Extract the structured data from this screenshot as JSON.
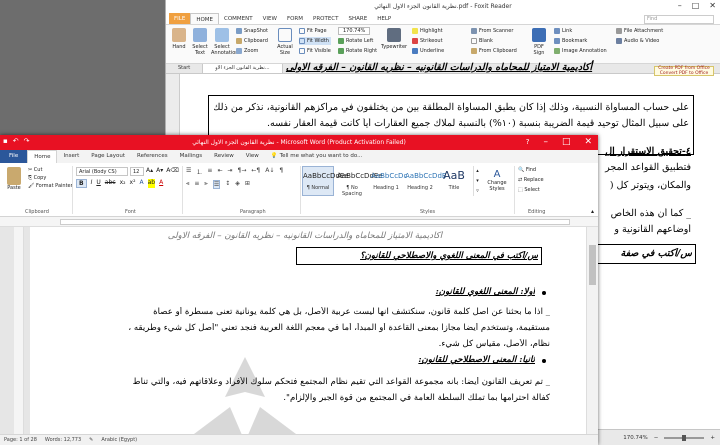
{
  "foxit": {
    "title": "نظرية القانون الجزء الاول النهائي.pdf - Foxit Reader",
    "tabs": [
      "FILE",
      "HOME",
      "COMMENT",
      "VIEW",
      "FORM",
      "PROTECT",
      "SHARE",
      "HELP"
    ],
    "ribbon": {
      "hand": "Hand",
      "select_text": "Select Text",
      "select_annotation": "Select Annotation",
      "snapshot": "SnapShot",
      "clipboard": "Clipboard",
      "zoom": "Zoom",
      "actual_size": "Actual Size",
      "fit_page": "Fit Page",
      "fit_width": "Fit Width",
      "fit_visible": "Fit Visible",
      "zoom_value": "170.74%",
      "rotate_left": "Rotate Left",
      "rotate_right": "Rotate Right",
      "typewriter": "Typewriter",
      "highlight": "Highlight",
      "strikeout": "Strikeout",
      "underline": "Underline",
      "from_scanner": "From Scanner",
      "blank": "Blank",
      "from_clipboard": "From Clipboard",
      "pdf_sign": "PDF Sign",
      "link": "Link",
      "bookmark": "Bookmark",
      "image_annotation": "Image Annotation",
      "file_attachment": "File Attachment",
      "audio_video": "Audio & Video",
      "find_placeholder": "Find"
    },
    "doc_tabs": [
      "Start",
      "نظرية القانون الجزء الاو..."
    ],
    "ad_text": "Create PDF from Office Convert PDF to Office",
    "page": {
      "header": "أكاديمية الامتياز للمحاماه والدراسات القانونيه – نظريه القانون – الفرقه الاولى",
      "lines": [
        "على حساب المساواة النسبية، وذلك إذا كان يطبق المساواة المطلقة بين من يختلفون في مراكزهم القانونية، نذكر من ذلك",
        "على سبيل المثال توحيد قيمة الضريبة بنسبة (١٠%) بالنسبة لملاك جميع العقارات أياً كانت قيمة العقار نفسه.",
        "٤-تحقيق الاستقرار ال",
        "فتطبيق القواعد المجر",
        "والمكان، ويتوتر كل (",
        "_ كما أن هذه الخاص",
        "أوضاعهم القانونية و",
        "س/أكتب في صفة"
      ]
    },
    "status": {
      "zoom": "170.74%"
    }
  },
  "word": {
    "title": "نظرية القانون الجزء الاول النهائي - Microsoft Word (Product Activation Failed)",
    "tabs": [
      "File",
      "Home",
      "Insert",
      "Page Layout",
      "References",
      "Mailings",
      "Review",
      "View"
    ],
    "tell_me": "Tell me what you want to do...",
    "ribbon": {
      "paste": "Paste",
      "cut": "Cut",
      "copy": "Copy",
      "format_painter": "Format Painter",
      "clipboard": "Clipboard",
      "font_name": "Arial (Body CS)",
      "font_size": "12",
      "font": "Font",
      "paragraph": "Paragraph",
      "styles": "Styles",
      "styles_list": [
        {
          "preview": "AaBbCcDdEe",
          "name": "¶ Normal"
        },
        {
          "preview": "AaBbCcDdEe",
          "name": "¶ No Spacing"
        },
        {
          "preview": "AaBbCcDc",
          "name": "Heading 1"
        },
        {
          "preview": "AaBbCcDdE",
          "name": "Heading 2"
        },
        {
          "preview": "AaB",
          "name": "Title"
        }
      ],
      "change_styles": "Change Styles",
      "find": "Find",
      "replace": "Replace",
      "select": "Select",
      "editing": "Editing"
    },
    "page": {
      "header": "أكاديمية الامتياز للمحاماه والدراسات القانونيه – نظريه القانون – الفرقه الاولى",
      "question": "س/أكتب في المعنى اللغوي والاصطلاحي للقانون؟",
      "h1": "أولا: المعنى اللغوي للقانون:",
      "p1a": "_ اذا ما بحثنا عن اصل كلمة قانون، سنكتشف انها ليست عربية الأصل، بل هي كلمة يونانية تعنى مسطرة أو عصاة",
      "p1b": "مستقيمة، وتستخدم أيضاً مجازاً بمعنى القاعدة أو المبدأ، أما في معجم اللغة العربية فنجد تعني \"أصل كل شيء وطريقه ،",
      "p1c": "نظام، الأصل، مقياس كل شيء.",
      "h2": "ثانيا: المعنى الاصطلاحي للقانون:",
      "p2a": "_ تم تعريف القانون أيضاً: بأنه مجموعة القواعد التي تقيم نظام المجتمع فتحكم سلوك الأفراد وعلاقاتهم فيه، والتي تناط",
      "p2b": "كفالة احترامها بما تملك السلطة العامة في المجتمع من قوة الجبر والإلزام\"."
    },
    "status": {
      "page": "Page: 1 of 28",
      "words": "Words: 12,773",
      "language": "Arabic (Egypt)"
    }
  }
}
